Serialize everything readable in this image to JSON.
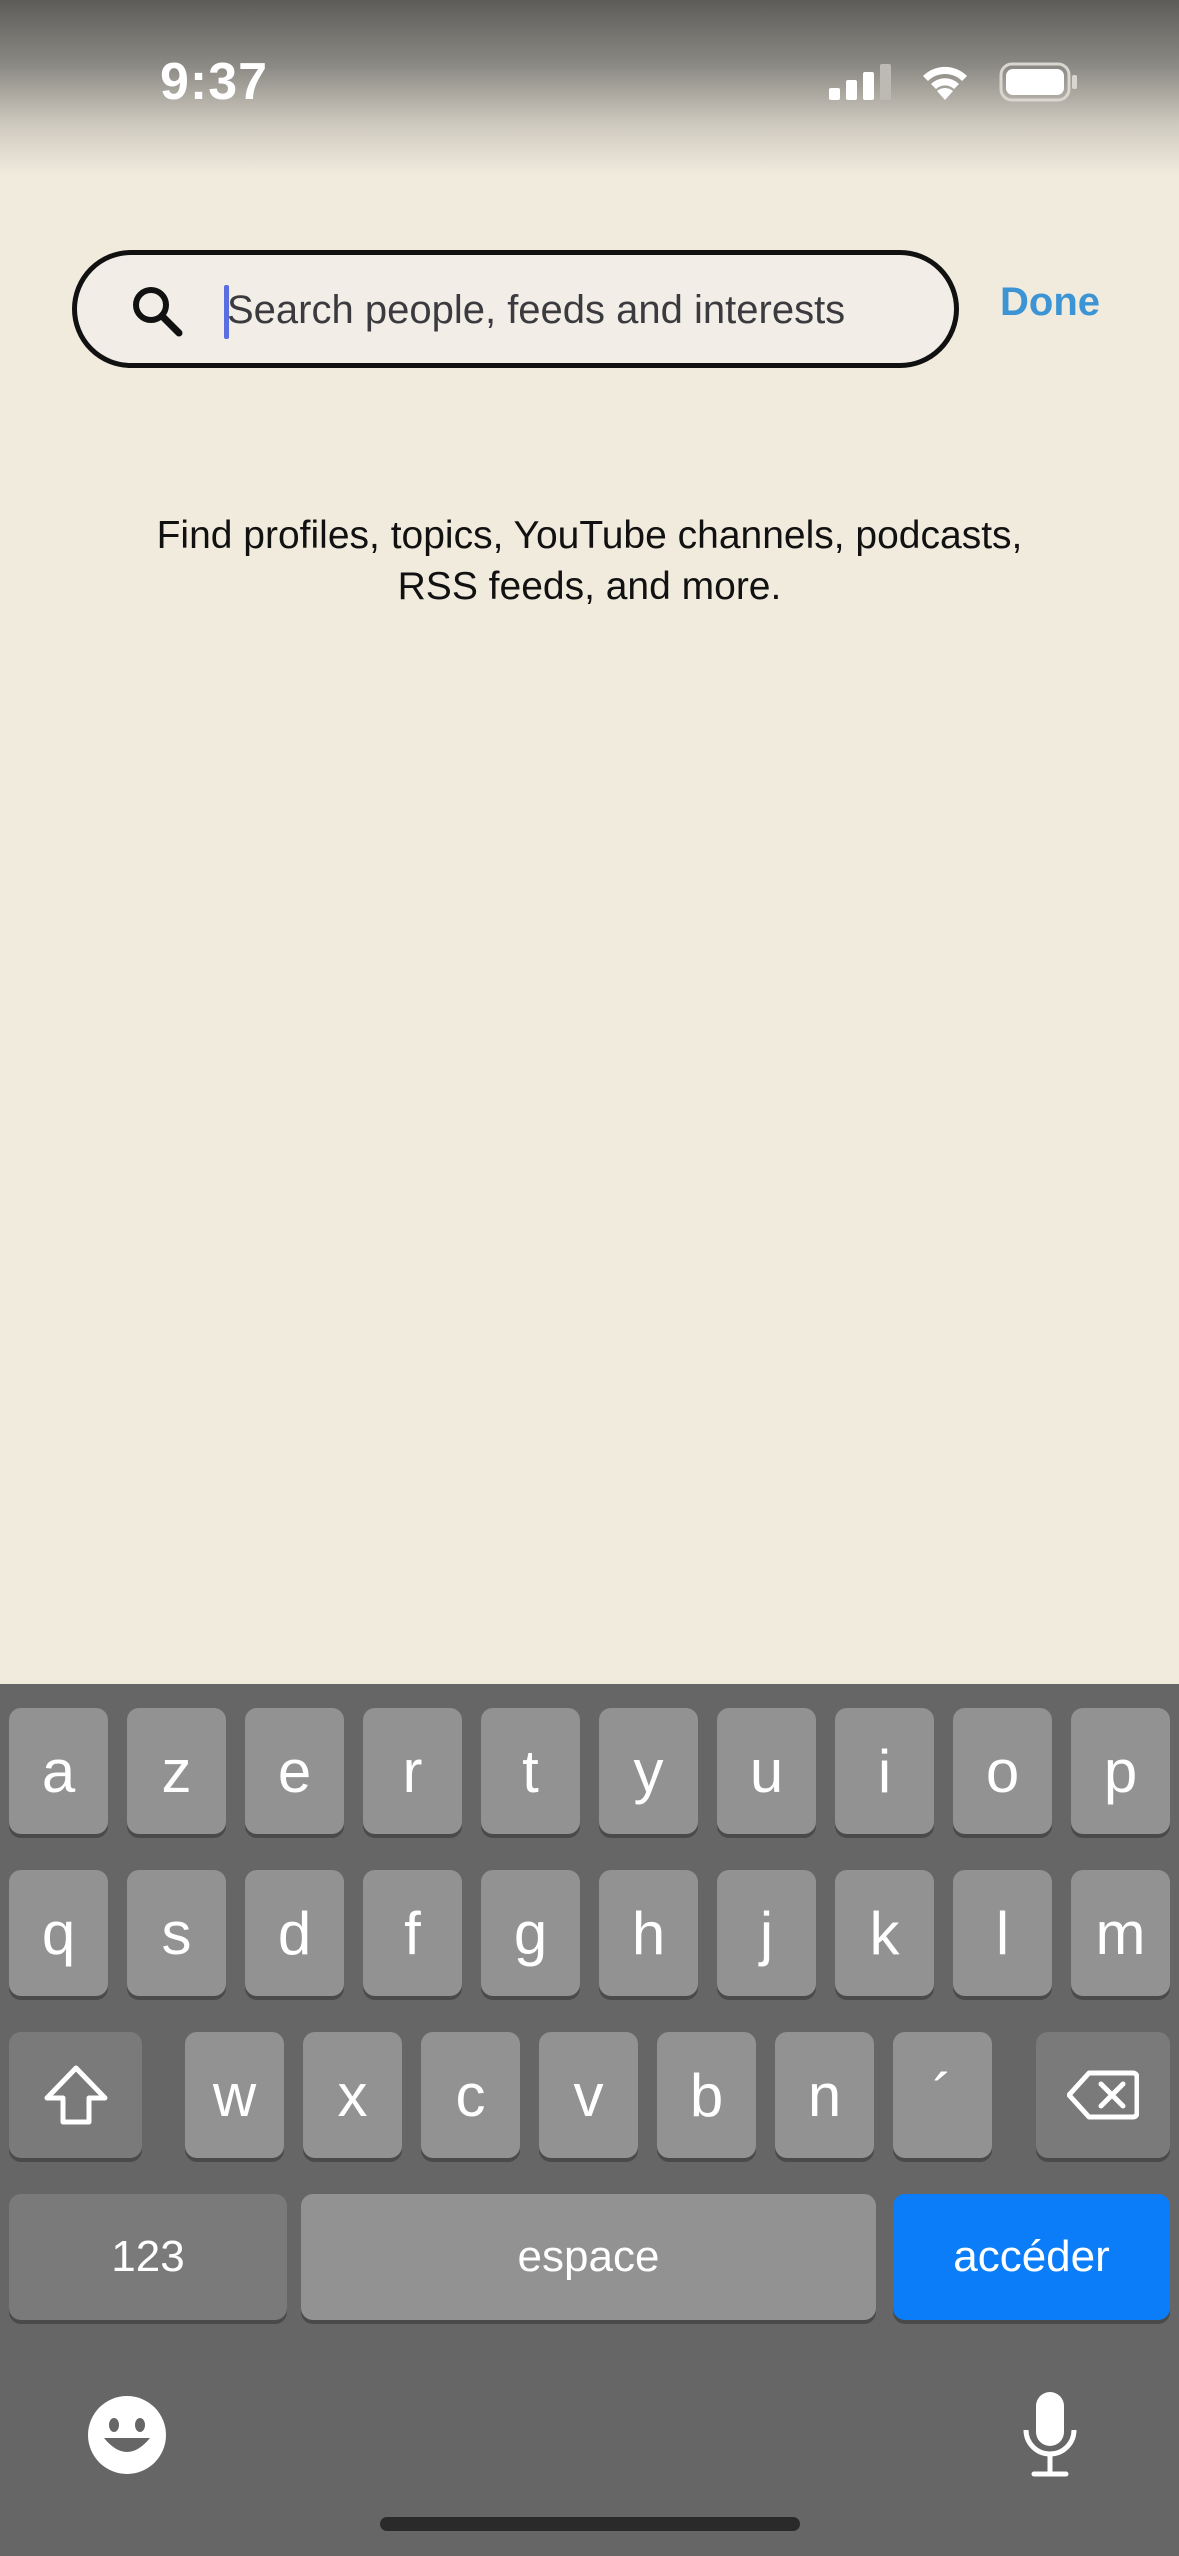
{
  "status_bar": {
    "time": "9:37"
  },
  "search": {
    "placeholder": "Search people, feeds and interests",
    "value": ""
  },
  "header": {
    "done_label": "Done"
  },
  "hint": {
    "line1": "Find profiles, topics, YouTube channels, podcasts,",
    "line2": "RSS feeds, and more."
  },
  "keyboard": {
    "row1": [
      "a",
      "z",
      "e",
      "r",
      "t",
      "y",
      "u",
      "i",
      "o",
      "p"
    ],
    "row2": [
      "q",
      "s",
      "d",
      "f",
      "g",
      "h",
      "j",
      "k",
      "l",
      "m"
    ],
    "row3": [
      "w",
      "x",
      "c",
      "v",
      "b",
      "n",
      "´"
    ],
    "numbers_label": "123",
    "space_label": "espace",
    "go_label": "accéder"
  },
  "colors": {
    "accent": "#3c94d4",
    "background": "#f1ebde",
    "keyboard_bg": "#666666",
    "go_key": "#0b7df9"
  }
}
